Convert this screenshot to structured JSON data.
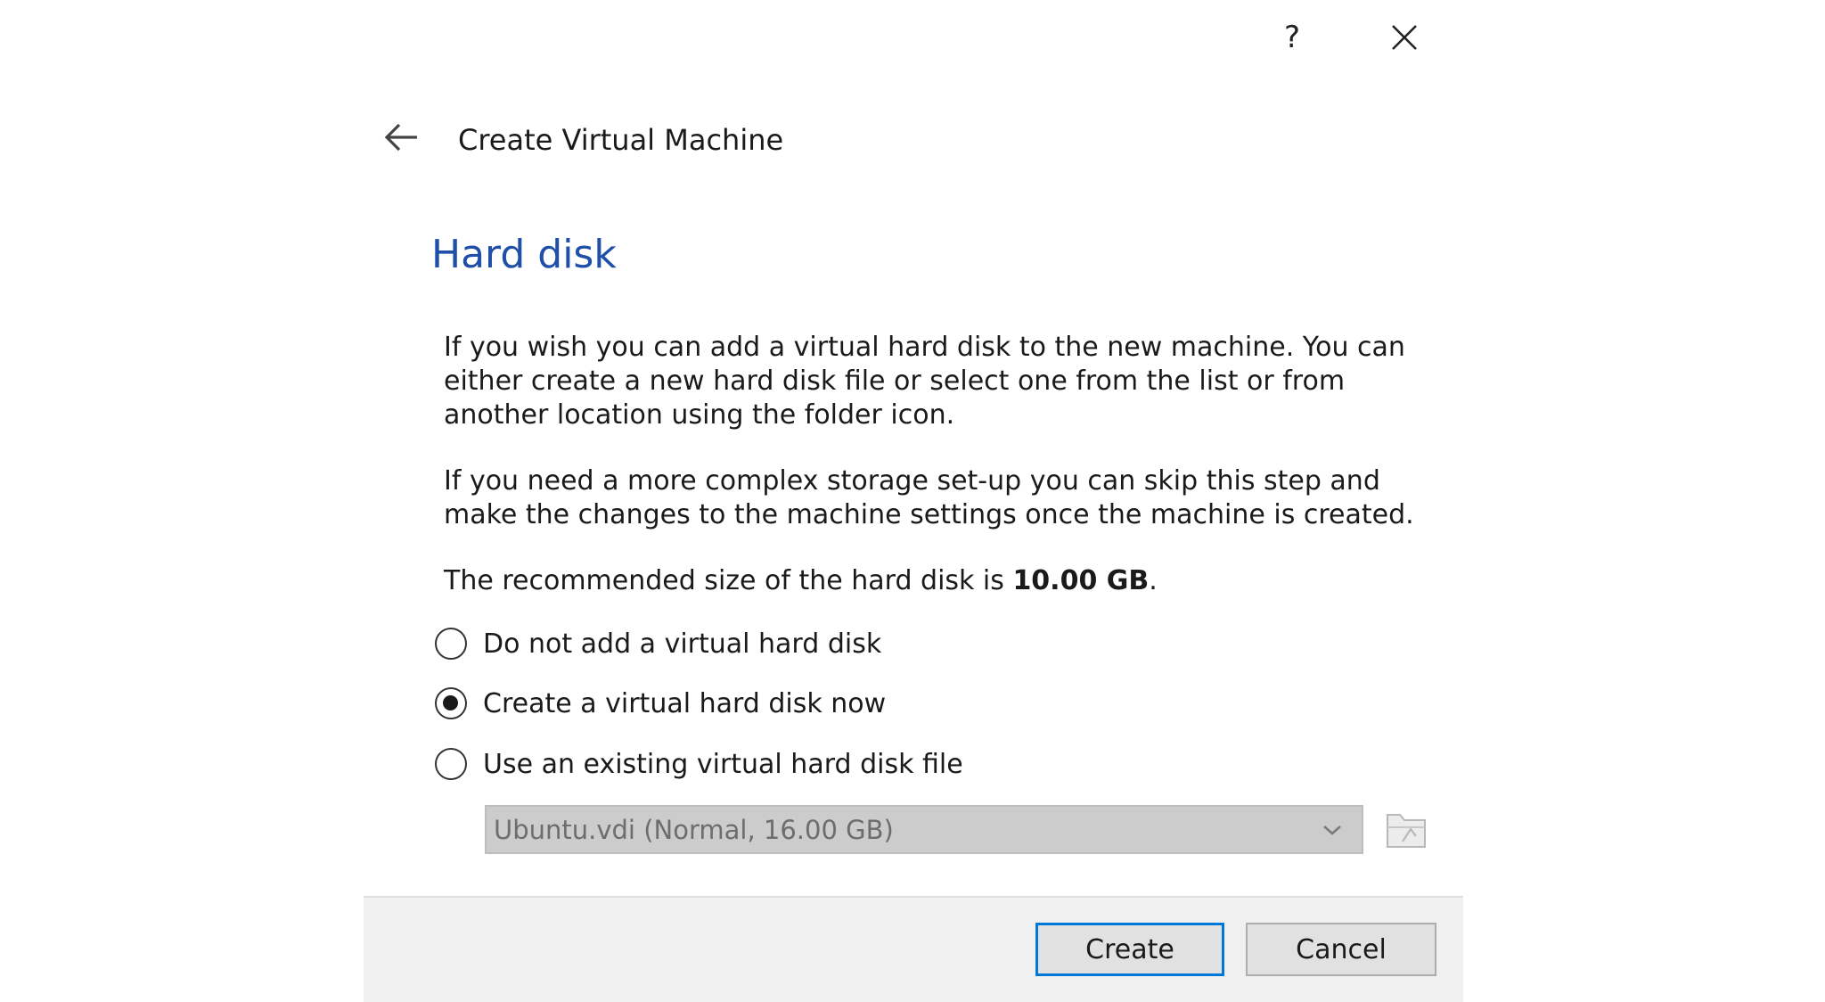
{
  "titlebar": {
    "help_label": "?",
    "close_icon": "close-icon"
  },
  "wizard": {
    "back_icon": "back-arrow-icon",
    "title": "Create Virtual Machine"
  },
  "page": {
    "heading": "Hard disk",
    "paragraph_1": "If you wish you can add a virtual hard disk to the new machine. You can either create a new hard disk file or select one from the list or from another location using the folder icon.",
    "paragraph_2": "If you need a more complex storage set-up you can skip this step and make the changes to the machine settings once the machine is created.",
    "recommend_prefix": "The recommended size of the hard disk is ",
    "recommend_size": "10.00 GB",
    "recommend_suffix": "."
  },
  "options": [
    {
      "label": "Do not add a virtual hard disk",
      "checked": false
    },
    {
      "label": "Create a virtual hard disk now",
      "checked": true
    },
    {
      "label": "Use an existing virtual hard disk file",
      "checked": false
    }
  ],
  "disk_select": {
    "value": "Ubuntu.vdi (Normal, 16.00 GB)",
    "enabled": false,
    "folder_icon": "folder-icon"
  },
  "buttons": {
    "create": "Create",
    "cancel": "Cancel"
  },
  "colors": {
    "heading": "#1f4fa8",
    "default_button_border": "#0078d7",
    "footer_bg": "#f0f0f0",
    "disabled_field_bg": "#cccccc"
  }
}
